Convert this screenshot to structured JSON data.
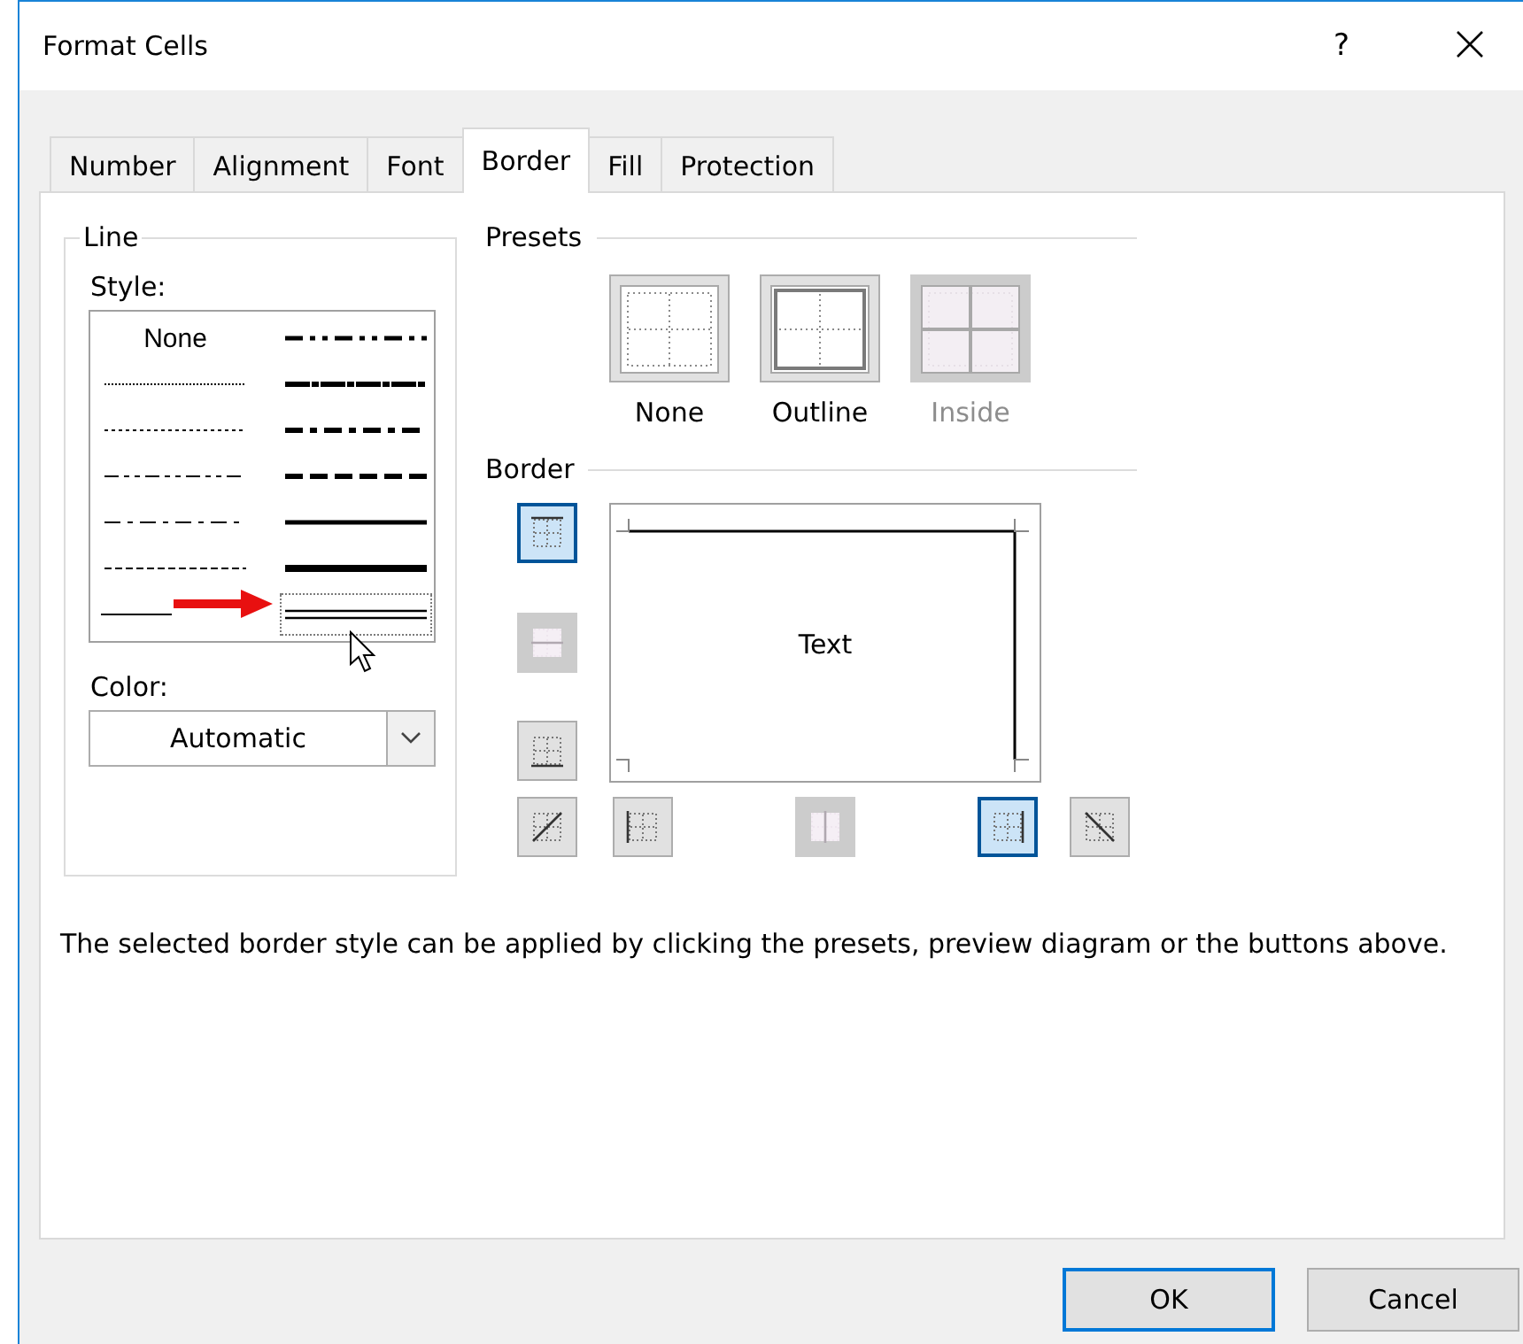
{
  "window": {
    "title": "Format Cells",
    "help": "?"
  },
  "tabs": [
    {
      "label": "Number",
      "selected": false
    },
    {
      "label": "Alignment",
      "selected": false
    },
    {
      "label": "Font",
      "selected": false
    },
    {
      "label": "Border",
      "selected": true
    },
    {
      "label": "Fill",
      "selected": false
    },
    {
      "label": "Protection",
      "selected": false
    }
  ],
  "line": {
    "title": "Line",
    "style_label": "Style:",
    "color_label": "Color:",
    "color_value": "Automatic",
    "styles": [
      {
        "kind": "none",
        "label": "None",
        "selected": false
      },
      {
        "kind": "medium-dash-dot-dot",
        "selected": false
      },
      {
        "kind": "hair",
        "selected": false
      },
      {
        "kind": "slant-dash-dot",
        "selected": false
      },
      {
        "kind": "dotted",
        "selected": false
      },
      {
        "kind": "medium-dash-dot",
        "selected": false
      },
      {
        "kind": "dash-dot-dot",
        "selected": false
      },
      {
        "kind": "medium-dashed",
        "selected": false
      },
      {
        "kind": "dash-dot",
        "selected": false
      },
      {
        "kind": "medium",
        "selected": false
      },
      {
        "kind": "dashed",
        "selected": false
      },
      {
        "kind": "thick",
        "selected": false
      },
      {
        "kind": "thin",
        "selected": false
      },
      {
        "kind": "double",
        "selected": true
      }
    ]
  },
  "presets": {
    "title": "Presets",
    "items": [
      {
        "kind": "none",
        "label": "None",
        "disabled": false
      },
      {
        "kind": "outline",
        "label": "Outline",
        "disabled": false
      },
      {
        "kind": "inside",
        "label": "Inside",
        "disabled": true
      }
    ]
  },
  "border": {
    "title": "Border",
    "preview_text": "Text",
    "buttons": [
      {
        "kind": "top",
        "selected": true,
        "disabled": false
      },
      {
        "kind": "horizontal",
        "selected": false,
        "disabled": true
      },
      {
        "kind": "bottom",
        "selected": false,
        "disabled": false
      },
      {
        "kind": "diagonal-up",
        "selected": false,
        "disabled": false
      },
      {
        "kind": "left",
        "selected": false,
        "disabled": false
      },
      {
        "kind": "vertical",
        "selected": false,
        "disabled": true
      },
      {
        "kind": "right",
        "selected": true,
        "disabled": false
      },
      {
        "kind": "diagonal-down",
        "selected": false,
        "disabled": false
      }
    ]
  },
  "note": "The selected border style can be applied by clicking the presets, preview diagram or the buttons above.",
  "buttons": [
    {
      "label": "OK",
      "default": true
    },
    {
      "label": "Cancel",
      "default": false
    }
  ]
}
